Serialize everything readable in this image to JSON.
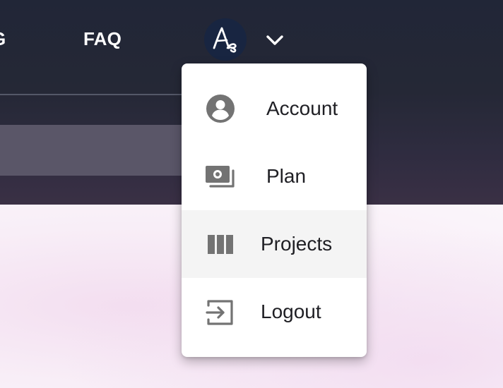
{
  "nav": {
    "partial_link": "G",
    "faq": "FAQ"
  },
  "account": {
    "avatar_initials": "As",
    "avatar_icon": "signature-avatar-icon",
    "dropdown_icon": "chevron-down-icon"
  },
  "menu": {
    "items": [
      {
        "label": "Account",
        "icon": "user-circle-icon"
      },
      {
        "label": "Plan",
        "icon": "cash-stack-icon"
      },
      {
        "label": "Projects",
        "icon": "columns-icon",
        "highlighted": true
      },
      {
        "label": "Logout",
        "icon": "logout-icon"
      }
    ]
  },
  "colors": {
    "header": "#222637",
    "avatar": "#182541",
    "icon": "#737373",
    "hover": "#f4f4f4",
    "text": "#1f1f24"
  }
}
